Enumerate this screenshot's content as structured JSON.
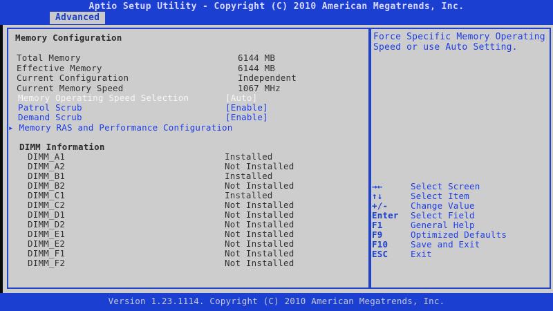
{
  "header": {
    "title": "Aptio Setup Utility - Copyright (C) 2010 American Megatrends, Inc.",
    "active_tab": "Advanced"
  },
  "memory_config": {
    "heading": "Memory Configuration",
    "info_rows": [
      {
        "label": "Total Memory",
        "value": "6144 MB"
      },
      {
        "label": "Effective Memory",
        "value": "6144 MB"
      },
      {
        "label": "Current Configuration",
        "value": "Independent"
      },
      {
        "label": "Current Memory Speed",
        "value": "1067 MHz"
      }
    ],
    "options": [
      {
        "label": "Memory Operating Speed Selection",
        "value": "[Auto]"
      },
      {
        "label": "Patrol Scrub",
        "value": "[Enable]"
      },
      {
        "label": "Demand Scrub",
        "value": "[Enable]"
      }
    ],
    "submenu": {
      "marker": "▸",
      "label": "Memory RAS and Performance Configuration"
    }
  },
  "dimm": {
    "heading": "DIMM Information",
    "slots": [
      {
        "name": "DIMM_A1",
        "status": "Installed"
      },
      {
        "name": "DIMM_A2",
        "status": "Not Installed"
      },
      {
        "name": "DIMM_B1",
        "status": "Installed"
      },
      {
        "name": "DIMM_B2",
        "status": "Not Installed"
      },
      {
        "name": "DIMM_C1",
        "status": "Installed"
      },
      {
        "name": "DIMM_C2",
        "status": "Not Installed"
      },
      {
        "name": "DIMM_D1",
        "status": "Not Installed"
      },
      {
        "name": "DIMM_D2",
        "status": "Not Installed"
      },
      {
        "name": "DIMM_E1",
        "status": "Not Installed"
      },
      {
        "name": "DIMM_E2",
        "status": "Not Installed"
      },
      {
        "name": "DIMM_F1",
        "status": "Not Installed"
      },
      {
        "name": "DIMM_F2",
        "status": "Not Installed"
      }
    ]
  },
  "help": {
    "line1": "Force Specific Memory Operating",
    "line2": "Speed or use Auto Setting."
  },
  "keys": [
    {
      "key": "→←",
      "desc": "Select Screen"
    },
    {
      "key": "↑↓",
      "desc": "Select Item"
    },
    {
      "key": "+/-",
      "desc": "Change Value"
    },
    {
      "key": "Enter",
      "desc": "Select Field"
    },
    {
      "key": "F1",
      "desc": "General Help"
    },
    {
      "key": "F9",
      "desc": "Optimized Defaults"
    },
    {
      "key": "F10",
      "desc": "Save and Exit"
    },
    {
      "key": "ESC",
      "desc": "Exit"
    }
  ],
  "footer": {
    "text": "Version 1.23.1114. Copyright (C) 2010 American Megatrends, Inc."
  },
  "colors": {
    "bar_blue": "#1a3fd1",
    "panel_gray": "#cdcdcd",
    "selected_white": "#f6f6f6",
    "option_blue": "#1e3ee6"
  }
}
